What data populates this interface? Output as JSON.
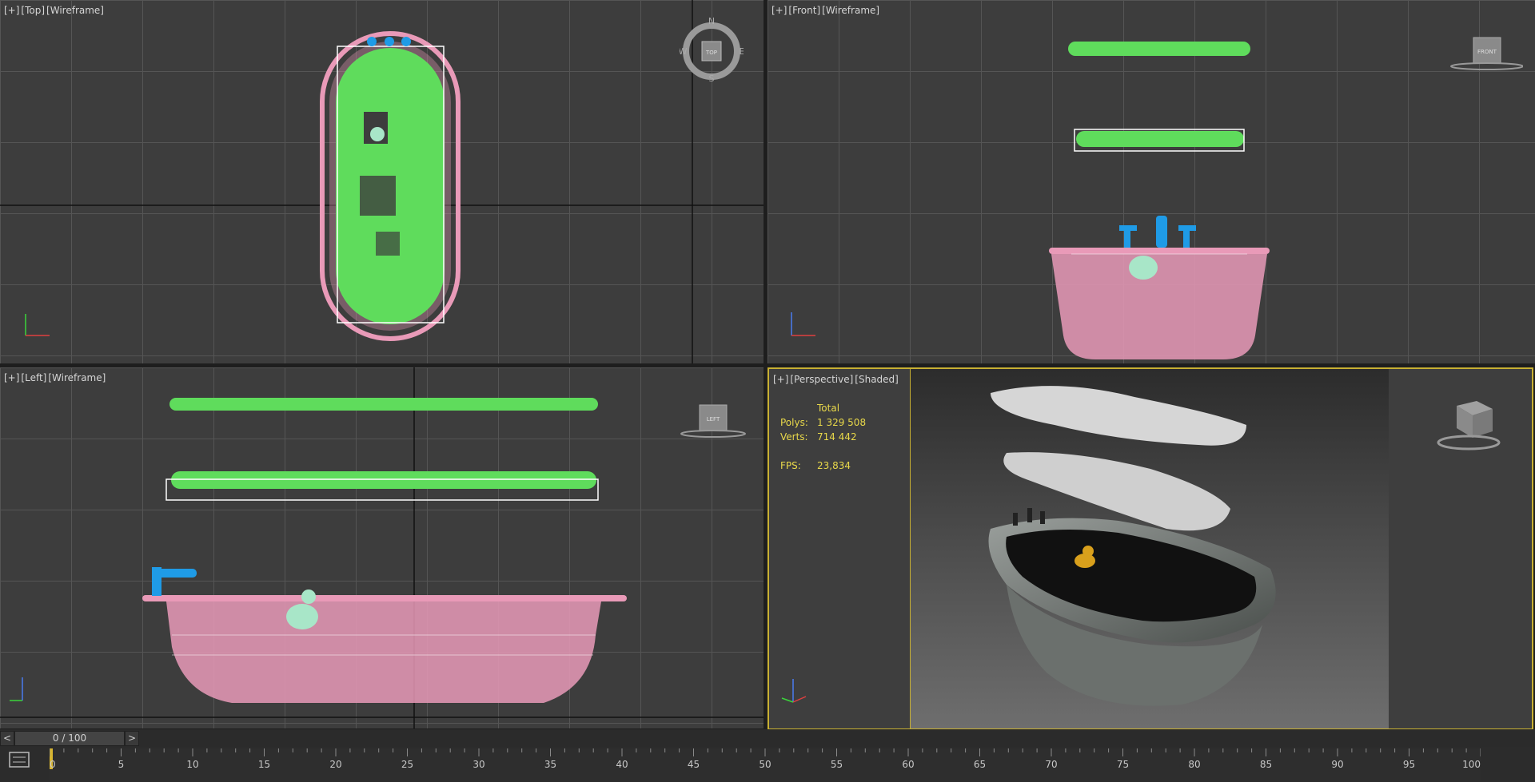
{
  "viewports": {
    "top": {
      "plus": "[+]",
      "name": "[Top]",
      "mode": "[Wireframe]",
      "compass": {
        "n": "N",
        "s": "S",
        "e": "E",
        "w": "W",
        "cube": "TOP"
      }
    },
    "front": {
      "plus": "[+]",
      "name": "[Front]",
      "mode": "[Wireframe]",
      "cube": "FRONT"
    },
    "left": {
      "plus": "[+]",
      "name": "[Left]",
      "mode": "[Wireframe]",
      "cube": "LEFT"
    },
    "perspective": {
      "plus": "[+]",
      "name": "[Perspective]",
      "mode": "[Shaded]",
      "stats": {
        "header": "Total",
        "polys_label": "Polys:",
        "polys": "1 329 508",
        "verts_label": "Verts:",
        "verts": "714 442",
        "fps_label": "FPS:",
        "fps": "23,834"
      }
    }
  },
  "colors": {
    "wire_pink": "#e99ab8",
    "foam_green": "#5fdc5c",
    "faucet_blue": "#1f9be6",
    "duck_mint": "#a8e6c8",
    "accent_yellow": "#c8b032"
  },
  "time_slider": {
    "value": "0 / 100",
    "prev": "<",
    "next": ">"
  },
  "track_bar": {
    "ticks": [
      "0",
      "5",
      "10",
      "15",
      "20",
      "25",
      "30",
      "35",
      "40",
      "45",
      "50",
      "55",
      "60",
      "65",
      "70",
      "75",
      "80",
      "85",
      "90",
      "95",
      "100"
    ]
  }
}
